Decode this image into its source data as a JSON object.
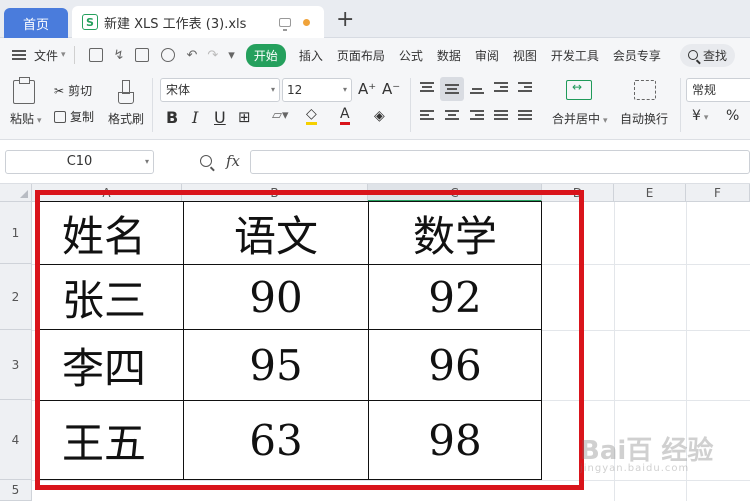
{
  "tabs": {
    "home": "首页",
    "file_icon": "S",
    "file_title": "新建 XLS 工作表 (3).xls",
    "new_tab": "+"
  },
  "menu": {
    "file": "文件",
    "items": [
      "开始",
      "插入",
      "页面布局",
      "公式",
      "数据",
      "审阅",
      "视图",
      "开发工具",
      "会员专享"
    ],
    "active": "开始",
    "search": "查找"
  },
  "ribbon": {
    "paste": "粘贴",
    "cut": "剪切",
    "copy": "复制",
    "format_painter": "格式刷",
    "font": "宋体",
    "font_size": "12",
    "grow": "A⁺",
    "shrink": "A⁻",
    "bold": "B",
    "italic": "I",
    "underline": "U",
    "merge_center": "合并居中",
    "wrap_text": "自动换行",
    "number_format": "常规",
    "currency": "¥",
    "percent": "%"
  },
  "formula_bar": {
    "cell_ref": "C10",
    "fx": "fx",
    "formula": ""
  },
  "grid": {
    "columns": [
      "A",
      "B",
      "C",
      "D",
      "E",
      "F"
    ],
    "rows": [
      "1",
      "2",
      "3",
      "4",
      "5"
    ],
    "selected_column": "C"
  },
  "table": {
    "header": [
      "姓名",
      "语文",
      "数学"
    ],
    "rows": [
      [
        "张三",
        "90",
        "92"
      ],
      [
        "李四",
        "95",
        "96"
      ],
      [
        "王五",
        "63",
        "98"
      ]
    ]
  },
  "colors": {
    "accent": "#25a05d",
    "home_tab": "#4a7cdc",
    "highlight_frame": "#d9141b"
  },
  "watermark": {
    "main": "Bai百 经验",
    "sub": "jingyan.baidu.com"
  }
}
